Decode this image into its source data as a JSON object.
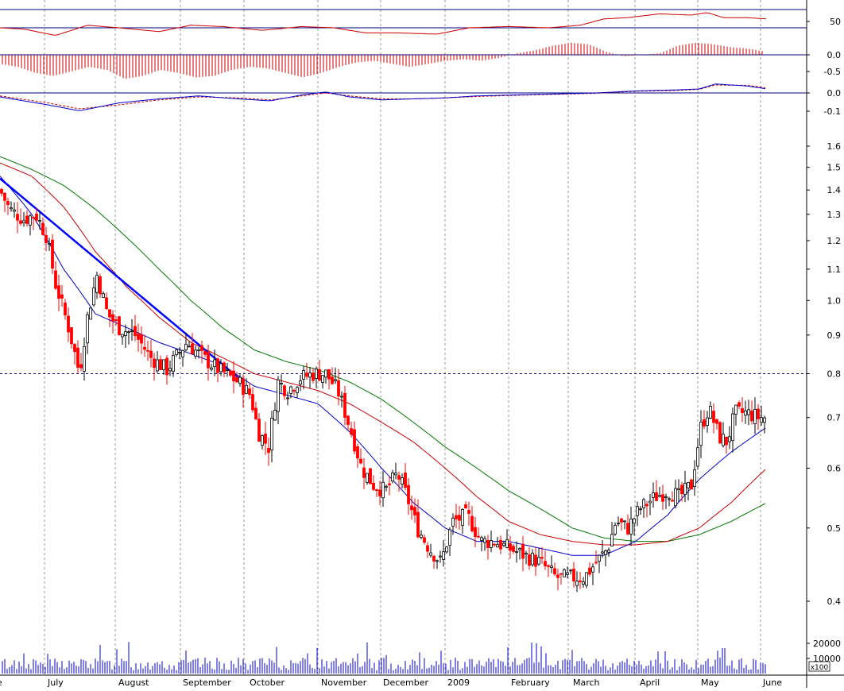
{
  "colors": {
    "background": "#ffffff",
    "grid": "#9a9a9a",
    "frame": "#000080",
    "up_candle": "#000000",
    "down_candle": "#ff0000",
    "sma_short": "#0000cc",
    "sma_mid": "#cc0000",
    "sma_long": "#007700",
    "trendline": "#0000ff",
    "volume": "#0000cc",
    "oscillator": "#cc0000"
  },
  "chart_data": {
    "type": "candlestick",
    "x_labels": [
      "e",
      "July",
      "August",
      "September",
      "October",
      "November",
      "December",
      "2009",
      "February",
      "March",
      "April",
      "May",
      "June"
    ],
    "price_axis": {
      "scale": "log",
      "ticks": [
        "1.6",
        "1.5",
        "1.4",
        "1.3",
        "1.2",
        "1.1",
        "1.0",
        "0.9",
        "0.8",
        "0.7",
        "0.6",
        "0.5",
        "0.4"
      ],
      "reference_level": 0.8
    },
    "price_path": [
      [
        0,
        1.4
      ],
      [
        12,
        1.32
      ],
      [
        30,
        1.28
      ],
      [
        45,
        1.3
      ],
      [
        58,
        1.22
      ],
      [
        70,
        1.05
      ],
      [
        85,
        0.93
      ],
      [
        100,
        0.8
      ],
      [
        110,
        0.95
      ],
      [
        122,
        1.08
      ],
      [
        135,
        0.96
      ],
      [
        150,
        0.92
      ],
      [
        170,
        0.9
      ],
      [
        190,
        0.84
      ],
      [
        210,
        0.81
      ],
      [
        235,
        0.88
      ],
      [
        255,
        0.84
      ],
      [
        275,
        0.81
      ],
      [
        300,
        0.78
      ],
      [
        315,
        0.75
      ],
      [
        325,
        0.67
      ],
      [
        338,
        0.64
      ],
      [
        350,
        0.78
      ],
      [
        362,
        0.76
      ],
      [
        378,
        0.79
      ],
      [
        395,
        0.8
      ],
      [
        410,
        0.8
      ],
      [
        425,
        0.76
      ],
      [
        440,
        0.68
      ],
      [
        455,
        0.6
      ],
      [
        470,
        0.57
      ],
      [
        485,
        0.56
      ],
      [
        500,
        0.59
      ],
      [
        512,
        0.55
      ],
      [
        525,
        0.5
      ],
      [
        540,
        0.47
      ],
      [
        555,
        0.45
      ],
      [
        570,
        0.51
      ],
      [
        588,
        0.52
      ],
      [
        605,
        0.48
      ],
      [
        622,
        0.48
      ],
      [
        640,
        0.47
      ],
      [
        660,
        0.46
      ],
      [
        680,
        0.45
      ],
      [
        700,
        0.43
      ],
      [
        715,
        0.43
      ],
      [
        735,
        0.43
      ],
      [
        750,
        0.45
      ],
      [
        765,
        0.47
      ],
      [
        775,
        0.51
      ],
      [
        790,
        0.5
      ],
      [
        805,
        0.53
      ],
      [
        825,
        0.55
      ],
      [
        840,
        0.56
      ],
      [
        855,
        0.55
      ],
      [
        870,
        0.57
      ],
      [
        882,
        0.68
      ],
      [
        892,
        0.72
      ],
      [
        905,
        0.66
      ],
      [
        915,
        0.65
      ],
      [
        925,
        0.71
      ],
      [
        940,
        0.71
      ],
      [
        955,
        0.7
      ],
      [
        965,
        0.7
      ]
    ],
    "sma_short": [
      [
        0,
        1.46
      ],
      [
        40,
        1.3
      ],
      [
        80,
        1.1
      ],
      [
        120,
        0.96
      ],
      [
        160,
        0.92
      ],
      [
        200,
        0.88
      ],
      [
        240,
        0.85
      ],
      [
        280,
        0.82
      ],
      [
        320,
        0.77
      ],
      [
        360,
        0.75
      ],
      [
        400,
        0.73
      ],
      [
        440,
        0.67
      ],
      [
        480,
        0.6
      ],
      [
        520,
        0.54
      ],
      [
        560,
        0.5
      ],
      [
        600,
        0.48
      ],
      [
        640,
        0.48
      ],
      [
        680,
        0.47
      ],
      [
        720,
        0.46
      ],
      [
        760,
        0.46
      ],
      [
        800,
        0.48
      ],
      [
        840,
        0.52
      ],
      [
        880,
        0.58
      ],
      [
        920,
        0.63
      ],
      [
        965,
        0.68
      ]
    ],
    "sma_mid": [
      [
        0,
        1.52
      ],
      [
        40,
        1.46
      ],
      [
        80,
        1.33
      ],
      [
        120,
        1.16
      ],
      [
        160,
        1.04
      ],
      [
        200,
        0.95
      ],
      [
        240,
        0.88
      ],
      [
        280,
        0.84
      ],
      [
        320,
        0.8
      ],
      [
        360,
        0.78
      ],
      [
        400,
        0.76
      ],
      [
        440,
        0.73
      ],
      [
        480,
        0.69
      ],
      [
        520,
        0.65
      ],
      [
        560,
        0.6
      ],
      [
        600,
        0.55
      ],
      [
        640,
        0.51
      ],
      [
        680,
        0.49
      ],
      [
        720,
        0.48
      ],
      [
        760,
        0.475
      ],
      [
        800,
        0.475
      ],
      [
        840,
        0.48
      ],
      [
        880,
        0.5
      ],
      [
        920,
        0.54
      ],
      [
        965,
        0.6
      ]
    ],
    "sma_long": [
      [
        0,
        1.55
      ],
      [
        40,
        1.49
      ],
      [
        80,
        1.42
      ],
      [
        120,
        1.32
      ],
      [
        160,
        1.21
      ],
      [
        200,
        1.1
      ],
      [
        240,
        1.0
      ],
      [
        280,
        0.92
      ],
      [
        320,
        0.86
      ],
      [
        360,
        0.83
      ],
      [
        400,
        0.81
      ],
      [
        440,
        0.78
      ],
      [
        480,
        0.74
      ],
      [
        520,
        0.69
      ],
      [
        560,
        0.64
      ],
      [
        600,
        0.6
      ],
      [
        640,
        0.56
      ],
      [
        680,
        0.53
      ],
      [
        720,
        0.5
      ],
      [
        760,
        0.485
      ],
      [
        800,
        0.48
      ],
      [
        840,
        0.48
      ],
      [
        880,
        0.49
      ],
      [
        920,
        0.51
      ],
      [
        965,
        0.54
      ]
    ],
    "trendline": [
      [
        0,
        1.45
      ],
      [
        300,
        0.79
      ]
    ],
    "rsi_panel": {
      "tick": "50",
      "path": [
        [
          0,
          50
        ],
        [
          30,
          49
        ],
        [
          70,
          44
        ],
        [
          110,
          52
        ],
        [
          150,
          50
        ],
        [
          200,
          47
        ],
        [
          240,
          52
        ],
        [
          280,
          51
        ],
        [
          330,
          48
        ],
        [
          380,
          51
        ],
        [
          420,
          50
        ],
        [
          460,
          46
        ],
        [
          500,
          46
        ],
        [
          550,
          45
        ],
        [
          590,
          50
        ],
        [
          640,
          51
        ],
        [
          690,
          50
        ],
        [
          730,
          52
        ],
        [
          760,
          57
        ],
        [
          790,
          58
        ],
        [
          830,
          61
        ],
        [
          870,
          60
        ],
        [
          890,
          62
        ],
        [
          910,
          58
        ],
        [
          940,
          58
        ],
        [
          965,
          57
        ]
      ]
    },
    "macd_hist_panel": {
      "ticks": [
        "0.0",
        "-0.5"
      ],
      "values": [
        -0.3,
        -0.4,
        -0.6,
        -0.7,
        -0.55,
        -0.4,
        -0.5,
        -0.8,
        -0.7,
        -0.5,
        -0.6,
        -0.75,
        -0.7,
        -0.5,
        -0.4,
        -0.45,
        -0.6,
        -0.75,
        -0.6,
        -0.4,
        -0.25,
        -0.2,
        -0.3,
        -0.4,
        -0.3,
        -0.2,
        -0.15,
        -0.2,
        -0.1,
        0.05,
        0.15,
        0.3,
        0.4,
        0.35,
        0.1,
        -0.05,
        0.0,
        0.05,
        0.3,
        0.4,
        0.35,
        0.25,
        0.2,
        0.1
      ]
    },
    "macd_line_panel": {
      "ticks": [
        "0.0",
        "-0.1"
      ],
      "macd": [
        [
          0,
          -0.02
        ],
        [
          60,
          -0.06
        ],
        [
          100,
          -0.09
        ],
        [
          150,
          -0.05
        ],
        [
          200,
          -0.03
        ],
        [
          250,
          -0.015
        ],
        [
          300,
          -0.03
        ],
        [
          340,
          -0.04
        ],
        [
          380,
          -0.01
        ],
        [
          410,
          0.005
        ],
        [
          440,
          -0.02
        ],
        [
          480,
          -0.035
        ],
        [
          520,
          -0.03
        ],
        [
          560,
          -0.025
        ],
        [
          600,
          -0.015
        ],
        [
          650,
          -0.01
        ],
        [
          700,
          -0.005
        ],
        [
          750,
          0.0
        ],
        [
          800,
          0.01
        ],
        [
          850,
          0.015
        ],
        [
          880,
          0.02
        ],
        [
          900,
          0.045
        ],
        [
          940,
          0.035
        ],
        [
          965,
          0.02
        ]
      ],
      "signal": [
        [
          0,
          -0.015
        ],
        [
          60,
          -0.05
        ],
        [
          100,
          -0.08
        ],
        [
          150,
          -0.06
        ],
        [
          200,
          -0.035
        ],
        [
          250,
          -0.02
        ],
        [
          300,
          -0.025
        ],
        [
          340,
          -0.035
        ],
        [
          380,
          -0.015
        ],
        [
          410,
          0.0
        ],
        [
          440,
          -0.015
        ],
        [
          480,
          -0.03
        ],
        [
          520,
          -0.03
        ],
        [
          560,
          -0.025
        ],
        [
          600,
          -0.018
        ],
        [
          650,
          -0.012
        ],
        [
          700,
          -0.007
        ],
        [
          750,
          -0.002
        ],
        [
          800,
          0.008
        ],
        [
          850,
          0.012
        ],
        [
          880,
          0.018
        ],
        [
          900,
          0.04
        ],
        [
          940,
          0.038
        ],
        [
          965,
          0.025
        ]
      ]
    },
    "volume_panel": {
      "ticks": [
        "20000",
        "10000"
      ],
      "multiplier": "x100"
    }
  }
}
